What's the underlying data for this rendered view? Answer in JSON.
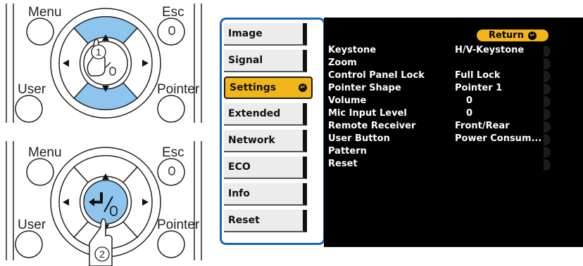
{
  "remote_top": {
    "menu_label": "Menu",
    "esc_label": "Esc",
    "user_label": "User",
    "pointer_label": "Pointer",
    "step_number": "1"
  },
  "remote_bottom": {
    "menu_label": "Menu",
    "esc_label": "Esc",
    "user_label": "User",
    "pointer_label": "Pointer",
    "step_number": "2"
  },
  "menu": {
    "items": [
      {
        "label": "Image"
      },
      {
        "label": "Signal"
      },
      {
        "label": "Settings"
      },
      {
        "label": "Extended"
      },
      {
        "label": "Network"
      },
      {
        "label": "ECO"
      },
      {
        "label": "Info"
      },
      {
        "label": "Reset"
      }
    ],
    "active_item": "Settings"
  },
  "settings_panel": {
    "return_label": "Return",
    "rows": [
      {
        "label": "Keystone",
        "value": "H/V-Keystone"
      },
      {
        "label": "Zoom",
        "value": ""
      },
      {
        "label": "Control Panel Lock",
        "value": "Full Lock"
      },
      {
        "label": "Pointer Shape",
        "value": "Pointer 1"
      },
      {
        "label": "Volume",
        "value": "0"
      },
      {
        "label": "Mic Input Level",
        "value": "0"
      },
      {
        "label": "Remote Receiver",
        "value": "Front/Rear"
      },
      {
        "label": "User Button",
        "value": "Power Consum..."
      },
      {
        "label": "Pattern",
        "value": ""
      },
      {
        "label": "Reset",
        "value": ""
      }
    ]
  },
  "colors": {
    "accent_blue": "#1a63b8",
    "highlight_orange": "#f2b51a",
    "button_blue": "#8ec5ee"
  }
}
